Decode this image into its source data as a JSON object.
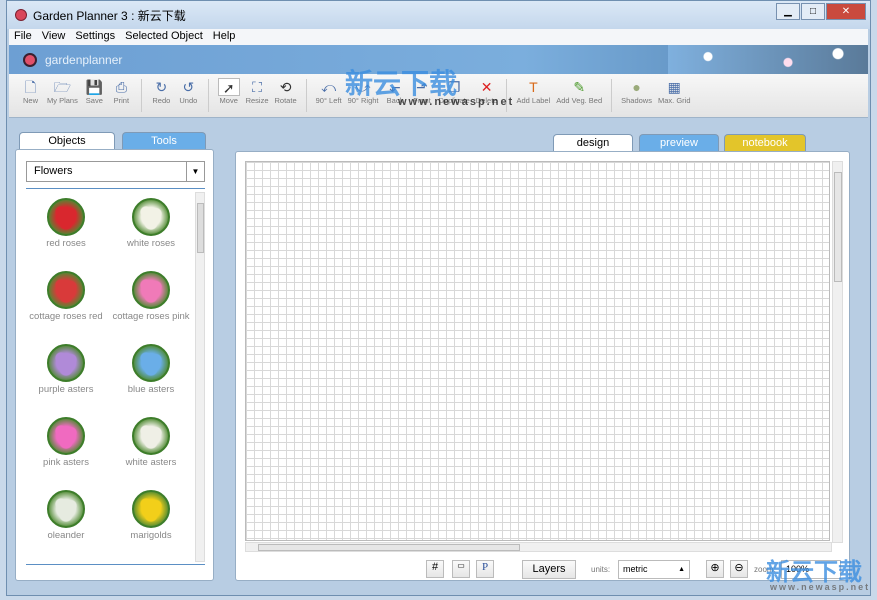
{
  "window": {
    "title": "Garden Planner 3 : 新云下载"
  },
  "menu": [
    "File",
    "View",
    "Settings",
    "Selected Object",
    "Help"
  ],
  "banner": {
    "logo_text": "gardenplanner"
  },
  "toolbar": [
    {
      "label": "New",
      "icon": "new-file-icon"
    },
    {
      "label": "My Plans",
      "icon": "folder-icon"
    },
    {
      "label": "Save",
      "icon": "save-icon"
    },
    {
      "label": "Print",
      "icon": "print-icon"
    },
    {
      "label": "Redo",
      "icon": "redo-icon"
    },
    {
      "label": "Undo",
      "icon": "undo-icon"
    },
    {
      "label": "Move",
      "icon": "move-arrow-icon"
    },
    {
      "label": "Resize",
      "icon": "resize-icon"
    },
    {
      "label": "Rotate",
      "icon": "rotate-icon"
    },
    {
      "label": "90° Left",
      "icon": "rotate-left-icon"
    },
    {
      "label": "90° Right",
      "icon": "rotate-right-icon"
    },
    {
      "label": "Back",
      "icon": "send-back-icon"
    },
    {
      "label": "Front",
      "icon": "bring-front-icon"
    },
    {
      "label": "Duplicate",
      "icon": "duplicate-icon"
    },
    {
      "label": "Delete",
      "icon": "delete-icon"
    },
    {
      "label": "Add Label",
      "icon": "text-label-icon"
    },
    {
      "label": "Add Veg. Bed",
      "icon": "veg-bed-icon"
    },
    {
      "label": "Shadows",
      "icon": "shadows-icon"
    },
    {
      "label": "Max. Grid",
      "icon": "max-grid-icon"
    }
  ],
  "left_panel": {
    "tabs": [
      "Objects",
      "Tools"
    ],
    "category": "Flowers",
    "items": [
      {
        "label": "red roses",
        "color": "#d9272e"
      },
      {
        "label": "white roses",
        "color": "#f2f2e6"
      },
      {
        "label": "cottage roses red",
        "color": "#d93a3a"
      },
      {
        "label": "cottage roses pink",
        "color": "#f07ab8"
      },
      {
        "label": "purple asters",
        "color": "#b08ad8"
      },
      {
        "label": "blue asters",
        "color": "#6aaee8"
      },
      {
        "label": "pink asters",
        "color": "#f06ac0"
      },
      {
        "label": "white asters",
        "color": "#efefe6"
      },
      {
        "label": "oleander",
        "color": "#e6ebe0"
      },
      {
        "label": "marigolds",
        "color": "#f2cf1a"
      }
    ]
  },
  "view_tabs": [
    {
      "label": "design",
      "color": "#ffffff"
    },
    {
      "label": "preview",
      "color": "#6aaee8"
    },
    {
      "label": "notebook",
      "color": "#e3c52a"
    }
  ],
  "bottom": {
    "layers": "Layers",
    "units_label": "units:",
    "units": "metric",
    "zoom_label": "zoom:",
    "zoom": "100%"
  },
  "watermark": {
    "text": "新云下载",
    "url": "www.newasp.net"
  }
}
